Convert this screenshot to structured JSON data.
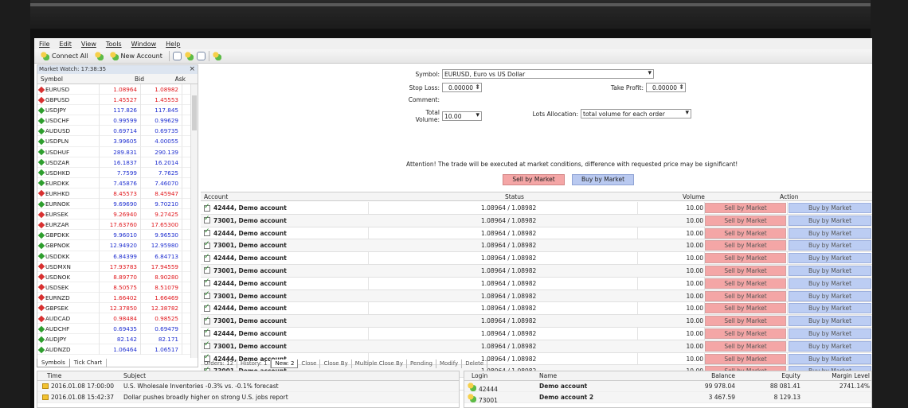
{
  "menu": [
    "File",
    "Edit",
    "View",
    "Tools",
    "Window",
    "Help"
  ],
  "toolbar": {
    "connect_all": "Connect All",
    "new_account": "New Account"
  },
  "market_watch": {
    "title": "Market Watch: 17:38:35",
    "headers": {
      "symbol": "Symbol",
      "bid": "Bid",
      "ask": "Ask"
    },
    "rows": [
      {
        "symbol": "EURUSD",
        "bid": "1.08964",
        "ask": "1.08982",
        "dir": "dn"
      },
      {
        "symbol": "GBPUSD",
        "bid": "1.45527",
        "ask": "1.45553",
        "dir": "dn"
      },
      {
        "symbol": "USDJPY",
        "bid": "117.826",
        "ask": "117.845",
        "dir": "up"
      },
      {
        "symbol": "USDCHF",
        "bid": "0.99599",
        "ask": "0.99629",
        "dir": "up"
      },
      {
        "symbol": "AUDUSD",
        "bid": "0.69714",
        "ask": "0.69735",
        "dir": "up"
      },
      {
        "symbol": "USDPLN",
        "bid": "3.99605",
        "ask": "4.00055",
        "dir": "up"
      },
      {
        "symbol": "USDHUF",
        "bid": "289.831",
        "ask": "290.139",
        "dir": "up"
      },
      {
        "symbol": "USDZAR",
        "bid": "16.1837",
        "ask": "16.2014",
        "dir": "up"
      },
      {
        "symbol": "USDHKD",
        "bid": "7.7599",
        "ask": "7.7625",
        "dir": "up"
      },
      {
        "symbol": "EURDKK",
        "bid": "7.45876",
        "ask": "7.46070",
        "dir": "up"
      },
      {
        "symbol": "EURHKD",
        "bid": "8.45573",
        "ask": "8.45947",
        "dir": "dn"
      },
      {
        "symbol": "EURNOK",
        "bid": "9.69690",
        "ask": "9.70210",
        "dir": "up"
      },
      {
        "symbol": "EURSEK",
        "bid": "9.26940",
        "ask": "9.27425",
        "dir": "dn"
      },
      {
        "symbol": "EURZAR",
        "bid": "17.63760",
        "ask": "17.65300",
        "dir": "dn"
      },
      {
        "symbol": "GBPDKK",
        "bid": "9.96010",
        "ask": "9.96530",
        "dir": "up"
      },
      {
        "symbol": "GBPNOK",
        "bid": "12.94920",
        "ask": "12.95980",
        "dir": "up"
      },
      {
        "symbol": "USDDKK",
        "bid": "6.84399",
        "ask": "6.84713",
        "dir": "up"
      },
      {
        "symbol": "USDMXN",
        "bid": "17.93783",
        "ask": "17.94559",
        "dir": "dn"
      },
      {
        "symbol": "USDNOK",
        "bid": "8.89770",
        "ask": "8.90280",
        "dir": "dn"
      },
      {
        "symbol": "USDSEK",
        "bid": "8.50575",
        "ask": "8.51079",
        "dir": "dn"
      },
      {
        "symbol": "EURNZD",
        "bid": "1.66402",
        "ask": "1.66469",
        "dir": "dn"
      },
      {
        "symbol": "GBPSEK",
        "bid": "12.37850",
        "ask": "12.38782",
        "dir": "dn"
      },
      {
        "symbol": "AUDCAD",
        "bid": "0.98484",
        "ask": "0.98525",
        "dir": "dn"
      },
      {
        "symbol": "AUDCHF",
        "bid": "0.69435",
        "ask": "0.69479",
        "dir": "up"
      },
      {
        "symbol": "AUDJPY",
        "bid": "82.142",
        "ask": "82.171",
        "dir": "up"
      },
      {
        "symbol": "AUDNZD",
        "bid": "1.06464",
        "ask": "1.06517",
        "dir": "up"
      }
    ],
    "tabs": [
      "Symbols",
      "Tick Chart"
    ]
  },
  "order_form": {
    "symbol_label": "Symbol:",
    "symbol_value": "EURUSD,  Euro vs US Dollar",
    "stop_loss_label": "Stop Loss:",
    "stop_loss_value": "0.00000",
    "take_profit_label": "Take Profit:",
    "take_profit_value": "0.00000",
    "comment_label": "Comment:",
    "total_volume_label": "Total Volume:",
    "total_volume_value": "10.00",
    "lots_allocation_label": "Lots Allocation:",
    "lots_allocation_value": "total volume for each order",
    "attention": "Attention! The trade will be executed at market conditions, difference with requested price may be significant!",
    "sell_button": "Sell by Market",
    "buy_button": "Buy by Market"
  },
  "accounts_grid": {
    "headers": {
      "account": "Account",
      "status": "Status",
      "volume": "Volume",
      "action": "Action"
    },
    "rows": [
      {
        "account": "42444, Demo account",
        "status": "1.08964 / 1.08982",
        "volume": "10.00"
      },
      {
        "account": "73001, Demo account",
        "status": "1.08964 / 1.08982",
        "volume": "10.00"
      },
      {
        "account": "42444, Demo account",
        "status": "1.08964 / 1.08982",
        "volume": "10.00"
      },
      {
        "account": "73001, Demo account",
        "status": "1.08964 / 1.08982",
        "volume": "10.00"
      },
      {
        "account": "42444, Demo account",
        "status": "1.08964 / 1.08982",
        "volume": "10.00"
      },
      {
        "account": "73001, Demo account",
        "status": "1.08964 / 1.08982",
        "volume": "10.00"
      },
      {
        "account": "42444, Demo account",
        "status": "1.08964 / 1.08982",
        "volume": "10.00"
      },
      {
        "account": "73001, Demo account",
        "status": "1.08964 / 1.08982",
        "volume": "10.00"
      },
      {
        "account": "42444, Demo account",
        "status": "1.08964 / 1.08982",
        "volume": "10.00"
      },
      {
        "account": "73001, Demo account",
        "status": "1.08964 / 1.08982",
        "volume": "10.00"
      },
      {
        "account": "42444, Demo account",
        "status": "1.08964 / 1.08982",
        "volume": "10.00"
      },
      {
        "account": "73001, Demo account",
        "status": "1.08964 / 1.08982",
        "volume": "10.00"
      },
      {
        "account": "42444, Demo account",
        "status": "1.08964 / 1.08982",
        "volume": "10.00"
      },
      {
        "account": "73001, Demo account",
        "status": "1.08964 / 1.08982",
        "volume": "10.00"
      },
      {
        "account": "42444, Demo account",
        "status": "1.08964 / 1.08982",
        "volume": "10.00"
      }
    ],
    "sell_label": "Sell by Market",
    "buy_label": "Buy by Market"
  },
  "terminal_tabs": [
    "Orders: 12",
    "History: 1",
    "New: 2",
    "Close",
    "Close By",
    "Multiple Close By",
    "Pending",
    "Modify",
    "Delete"
  ],
  "news": {
    "headers": {
      "time": "Time",
      "subject": "Subject"
    },
    "rows": [
      {
        "time": "2016.01.08 17:00:00",
        "subject": "U.S. Wholesale Inventories -0.3% vs. -0.1% forecast"
      },
      {
        "time": "2016.01.08 15:42:37",
        "subject": "Dollar pushes broadly higher on strong U.S. jobs report"
      }
    ]
  },
  "accounts_summary": {
    "headers": {
      "login": "Login",
      "name": "Name",
      "balance": "Balance",
      "equity": "Equity",
      "margin_level": "Margin Level"
    },
    "rows": [
      {
        "login": "42444",
        "name": "Demo account",
        "balance": "99 978.04",
        "equity": "88 081.41",
        "margin_level": "2741.14%"
      },
      {
        "login": "73001",
        "name": "Demo account 2",
        "balance": "3 467.59",
        "equity": "8 129.13",
        "margin_level": ""
      }
    ]
  }
}
